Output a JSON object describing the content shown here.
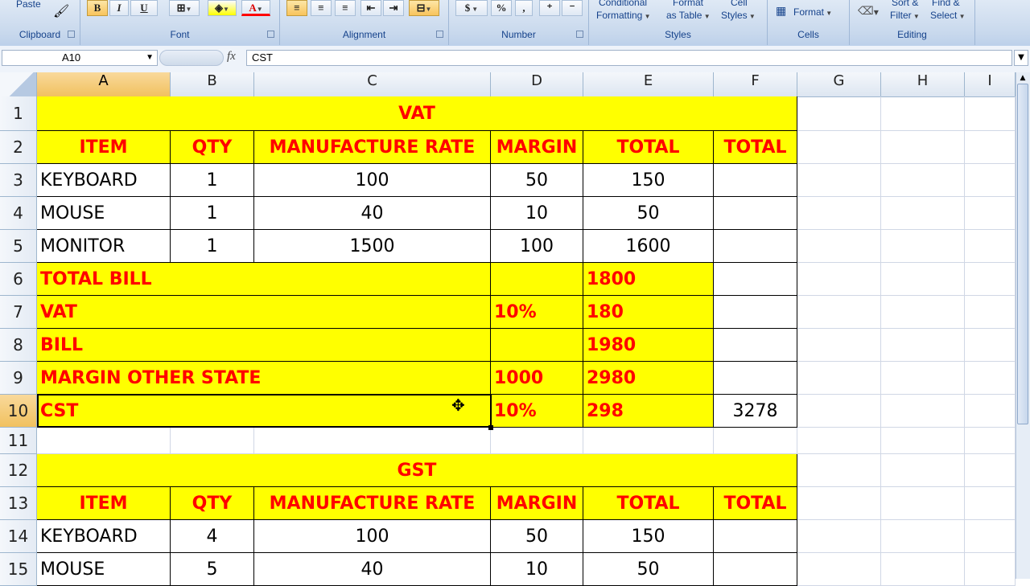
{
  "ribbon": {
    "clipboard": {
      "label": "Clipboard",
      "paste_label": "Paste"
    },
    "font": {
      "label": "Font",
      "bold": "B",
      "italic": "I",
      "underline": "U",
      "font_color": "A"
    },
    "alignment": {
      "label": "Alignment"
    },
    "number": {
      "label": "Number",
      "currency": "$",
      "percent": "%",
      "comma": ","
    },
    "styles": {
      "label": "Styles",
      "conditional_line1": "Conditional",
      "conditional_line2": "Formatting",
      "format_table_line1": "Format",
      "format_table_line2": "as Table",
      "cell_styles_line1": "Cell",
      "cell_styles_line2": "Styles"
    },
    "cells": {
      "label": "Cells",
      "format_label": "Format"
    },
    "editing": {
      "label": "Editing",
      "sort_line1": "Sort &",
      "sort_line2": "Filter",
      "find_line1": "Find &",
      "find_line2": "Select"
    }
  },
  "formula_bar": {
    "name_box": "A10",
    "fx": "fx",
    "content": "CST"
  },
  "columns": [
    "A",
    "B",
    "C",
    "D",
    "E",
    "F",
    "G",
    "H",
    "I"
  ],
  "rows": [
    "1",
    "2",
    "3",
    "4",
    "5",
    "6",
    "7",
    "8",
    "9",
    "10",
    "11",
    "12",
    "13",
    "14",
    "15"
  ],
  "sheet": {
    "vat_title": "VAT",
    "gst_title": "GST",
    "headers": [
      "ITEM",
      "QTY",
      "MANUFACTURE RATE",
      "MARGIN",
      "TOTAL",
      "TOTAL"
    ],
    "vat_items": [
      [
        "KEYBOARD",
        "1",
        "100",
        "50",
        "150"
      ],
      [
        "MOUSE",
        "1",
        "40",
        "10",
        "50"
      ],
      [
        "MONITOR",
        "1",
        "1500",
        "100",
        "1600"
      ]
    ],
    "summary": [
      {
        "label": "TOTAL BILL",
        "d": "",
        "e": "1800",
        "f": ""
      },
      {
        "label": "VAT",
        "d": "10%",
        "e": "180",
        "f": ""
      },
      {
        "label": "BILL",
        "d": "",
        "e": "1980",
        "f": ""
      },
      {
        "label": "MARGIN OTHER STATE",
        "d": "1000",
        "e": "2980",
        "f": ""
      },
      {
        "label": "CST",
        "d": "10%",
        "e": "298",
        "f": "3278"
      }
    ],
    "gst_items": [
      [
        "KEYBOARD",
        "4",
        "100",
        "50",
        "150"
      ],
      [
        "MOUSE",
        "5",
        "40",
        "10",
        "50"
      ]
    ]
  },
  "colors": {
    "fill": "#ffff00",
    "header_text": "#ff0000",
    "selection": "#f1c15f"
  }
}
